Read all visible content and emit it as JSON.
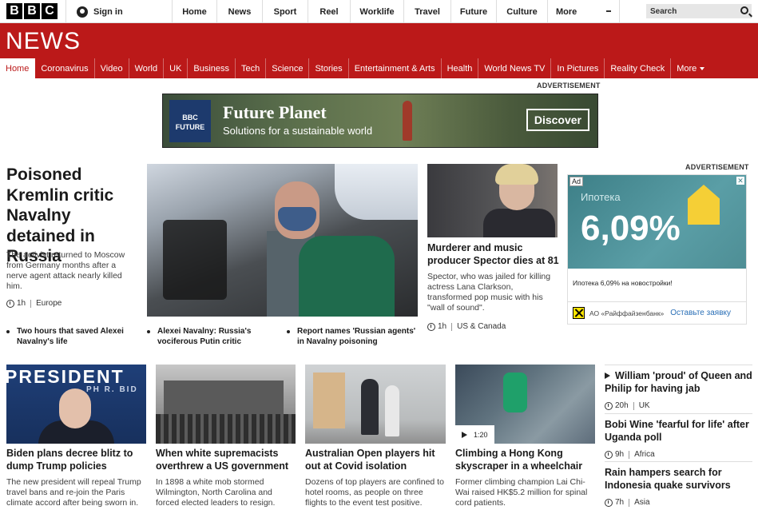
{
  "topbar": {
    "logo_letters": [
      "B",
      "B",
      "C"
    ],
    "signin": "Sign in",
    "nav": [
      "Home",
      "News",
      "Sport",
      "Reel",
      "Worklife",
      "Travel",
      "Future",
      "Culture",
      "More"
    ],
    "search_placeholder": "Search"
  },
  "newsbar": {
    "logo": "NEWS",
    "nav": [
      "Home",
      "Coronavirus",
      "Video",
      "World",
      "UK",
      "Business",
      "Tech",
      "Science",
      "Stories",
      "Entertainment & Arts",
      "Health",
      "World News TV",
      "In Pictures",
      "Reality Check",
      "More"
    ]
  },
  "ads": {
    "label": "ADVERTISEMENT",
    "banner": {
      "logo_line1": "BBC",
      "logo_line2": "FUTURE",
      "title": "Future Planet",
      "subtitle": "Solutions for a sustainable world",
      "cta": "Discover"
    },
    "side": {
      "badge": "Ad",
      "close": "✕",
      "heading": "Ипотека",
      "rate": "6,09%",
      "text": "Ипотека 6,09% на новостройки!",
      "advertiser": "АО «Райффайзенбанк»",
      "cta": "Оставьте заявку"
    }
  },
  "lead": {
    "title": "Poisoned Kremlin critic Navalny detained in Russia",
    "summary": "The activist returned to Moscow from Germany months after a nerve agent attack nearly killed him.",
    "time": "1h",
    "tag": "Europe",
    "related": [
      "Two hours that saved Alexei Navalny's life",
      "Alexei Navalny: Russia's vociferous Putin critic",
      "Report names 'Russian agents' in Navalny poisoning"
    ]
  },
  "second": {
    "title": "Murderer and music producer Spector dies at 81",
    "summary": "Spector, who was jailed for killing actress Lana Clarkson, transformed pop music with his \"wall of sound\".",
    "time": "1h",
    "tag": "US & Canada"
  },
  "bottom": [
    {
      "title": "Biden plans decree blitz to dump Trump policies",
      "summary": "The new president will repeal Trump travel bans and re-join the Paris climate accord after being sworn in.",
      "image_text_1": "PRESIDENT",
      "image_text_2": "PH R. BID"
    },
    {
      "title": "When white supremacists overthrew a US government",
      "summary": "In 1898 a white mob stormed Wilmington, North Carolina and forced elected leaders to resign."
    },
    {
      "title": "Australian Open players hit out at Covid isolation",
      "summary": "Dozens of top players are confined to hotel rooms, as people on three flights to the event test positive."
    },
    {
      "title": "Climbing a Hong Kong skyscraper in a wheelchair",
      "summary": "Former climbing champion Lai Chi-Wai raised HK$5.2 million for spinal cord patients.",
      "video_duration": "1:20"
    }
  ],
  "right_list": [
    {
      "title": "William 'proud' of Queen and Philip for having jab",
      "time": "20h",
      "tag": "UK",
      "video": true
    },
    {
      "title": "Bobi Wine 'fearful for life' after Uganda poll",
      "time": "9h",
      "tag": "Africa",
      "video": false
    },
    {
      "title": "Rain hampers search for Indonesia quake survivors",
      "time": "7h",
      "tag": "Asia",
      "video": false
    }
  ],
  "colors": {
    "brand_red": "#bb1919",
    "link_blue": "#2a6fb6"
  }
}
